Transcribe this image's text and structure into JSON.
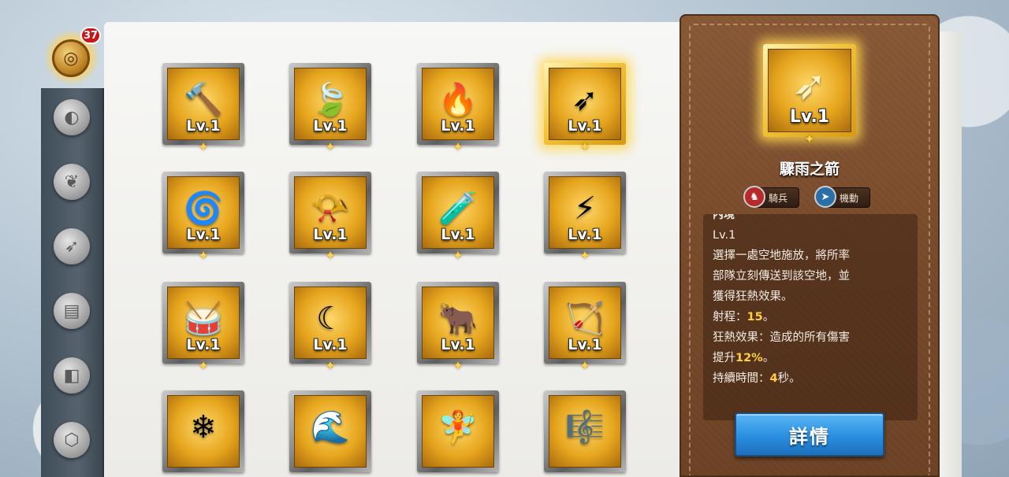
{
  "sidebar": {
    "badge_count": "37",
    "items": [
      {
        "icon": "ring-icon",
        "glyph": "◎",
        "active": true
      },
      {
        "icon": "orb-icon",
        "glyph": "◐",
        "active": false
      },
      {
        "icon": "horn-icon",
        "glyph": "❦",
        "active": false
      },
      {
        "icon": "arrow-icon",
        "glyph": "➶",
        "active": false
      },
      {
        "icon": "armor-icon",
        "glyph": "▤",
        "active": false
      },
      {
        "icon": "stone-icon",
        "glyph": "◧",
        "active": false
      },
      {
        "icon": "gem-icon",
        "glyph": "⬡",
        "active": false
      }
    ]
  },
  "grid": {
    "cards": [
      {
        "name": "hammer-item",
        "glyph": "🔨",
        "level": "Lv.1",
        "selected": false
      },
      {
        "name": "green-amulet-item",
        "glyph": "🍃",
        "level": "Lv.1",
        "selected": false
      },
      {
        "name": "fire-crystal-item",
        "glyph": "🔥",
        "level": "Lv.1",
        "selected": false
      },
      {
        "name": "golden-arrows-item",
        "glyph": "➶",
        "level": "Lv.1",
        "selected": true
      },
      {
        "name": "blue-wing-axe-item",
        "glyph": "🌀",
        "level": "Lv.1",
        "selected": false
      },
      {
        "name": "silver-horn-item",
        "glyph": "📯",
        "level": "Lv.1",
        "selected": false
      },
      {
        "name": "green-vial-item",
        "glyph": "🧪",
        "level": "Lv.1",
        "selected": false
      },
      {
        "name": "lightning-sword-item",
        "glyph": "⚡",
        "level": "Lv.1",
        "selected": false
      },
      {
        "name": "war-drum-item",
        "glyph": "🥁",
        "level": "Lv.1",
        "selected": false
      },
      {
        "name": "crescent-blade-item",
        "glyph": "☾",
        "level": "Lv.1",
        "selected": false
      },
      {
        "name": "bull-helm-item",
        "glyph": "🐂",
        "level": "Lv.1",
        "selected": false
      },
      {
        "name": "golden-bow-item",
        "glyph": "🏹",
        "level": "Lv.1",
        "selected": false
      },
      {
        "name": "ice-spear-item",
        "glyph": "❄",
        "level": "",
        "selected": false
      },
      {
        "name": "frost-wing-item",
        "glyph": "🌊",
        "level": "",
        "selected": false
      },
      {
        "name": "ice-fairy-item",
        "glyph": "🧚",
        "level": "",
        "selected": false
      },
      {
        "name": "golden-harp-item",
        "glyph": "🎼",
        "level": "",
        "selected": false
      }
    ]
  },
  "detail": {
    "level": "Lv.1",
    "glyph": "➶",
    "name": "驟雨之箭",
    "tags": [
      {
        "label": "騎兵",
        "icon": "cavalry-icon",
        "glyph": "♞",
        "color": "#b8292b"
      },
      {
        "label": "機動",
        "icon": "mobility-icon",
        "glyph": "➤",
        "color": "#2a6fa8"
      }
    ],
    "section_head": "內境",
    "desc_level": "Lv.1",
    "desc_lines": [
      "選擇一處空地施放，將所率",
      "部隊立刻傳送到該空地，並",
      "獲得狂熱效果。"
    ],
    "range_label": "射程：",
    "range_value": "15",
    "range_suffix": "。",
    "effect_label": "狂熱效果：造成的所有傷害",
    "effect_prefix": "提升",
    "effect_value": "12%",
    "effect_suffix": "。",
    "duration_label": "持續時間：",
    "duration_value": "4",
    "duration_suffix": "秒。",
    "button_label": "詳情"
  }
}
